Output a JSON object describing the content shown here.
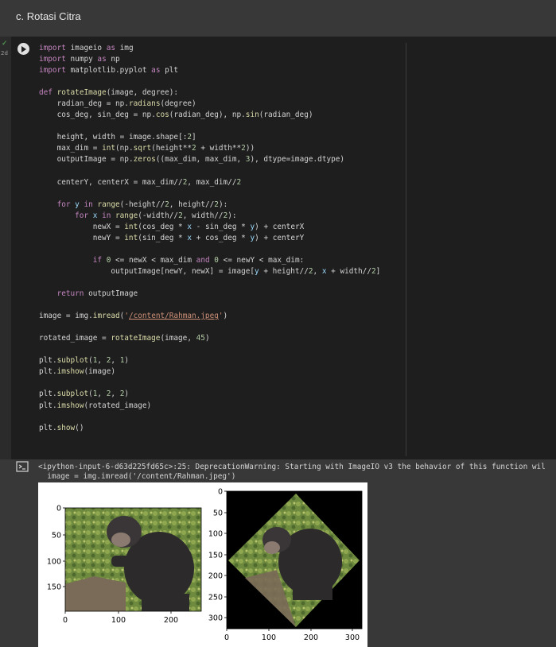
{
  "header": {
    "title": "c. Rotasi Citra"
  },
  "cell": {
    "exec_status": "✓",
    "exec_time": "2d",
    "code_lines": [
      "import imageio as img",
      "import numpy as np",
      "import matplotlib.pyplot as plt",
      "",
      "def rotateImage(image, degree):",
      "    radian_deg = np.radians(degree)",
      "    cos_deg, sin_deg = np.cos(radian_deg), np.sin(radian_deg)",
      "",
      "    height, width = image.shape[:2]",
      "    max_dim = int(np.sqrt(height**2 + width**2))",
      "    outputImage = np.zeros((max_dim, max_dim, 3), dtype=image.dtype)",
      "",
      "    centerY, centerX = max_dim//2, max_dim//2",
      "",
      "    for y in range(-height//2, height//2):",
      "        for x in range(-width//2, width//2):",
      "            newX = int(cos_deg * x - sin_deg * y) + centerX",
      "            newY = int(sin_deg * x + cos_deg * y) + centerY",
      "",
      "            if 0 <= newX < max_dim and 0 <= newY < max_dim:",
      "                outputImage[newY, newX] = image[y + height//2, x + width//2]",
      "",
      "    return outputImage",
      "",
      "image = img.imread('/content/Rahman.jpeg')",
      "",
      "rotated_image = rotateImage(image, 45)",
      "",
      "plt.subplot(1, 2, 1)",
      "plt.imshow(image)",
      "",
      "plt.subplot(1, 2, 2)",
      "plt.imshow(rotated_image)",
      "",
      "plt.show()"
    ]
  },
  "output": {
    "warning_line1": "<ipython-input-6-d63d225fd65c>:25: DeprecationWarning: Starting with ImageIO v3 the behavior of this function wil",
    "warning_line2": "  image = img.imread('/content/Rahman.jpeg')",
    "plot1": {
      "y_ticks": [
        "0",
        "50",
        "100",
        "150"
      ],
      "x_ticks": [
        "0",
        "100",
        "200"
      ]
    },
    "plot2": {
      "y_ticks": [
        "0",
        "50",
        "100",
        "150",
        "200",
        "250",
        "300"
      ],
      "x_ticks": [
        "0",
        "100",
        "200",
        "300"
      ]
    }
  },
  "colors": {
    "keyword": "#c586c0",
    "function": "#dcdcaa",
    "number": "#b5cea8",
    "string": "#ce9178",
    "variable": "#9cdcfe",
    "default": "#d4d4d4"
  },
  "icons": {
    "run": "play-icon",
    "output": "output-toggle-icon",
    "status": "check-icon"
  }
}
